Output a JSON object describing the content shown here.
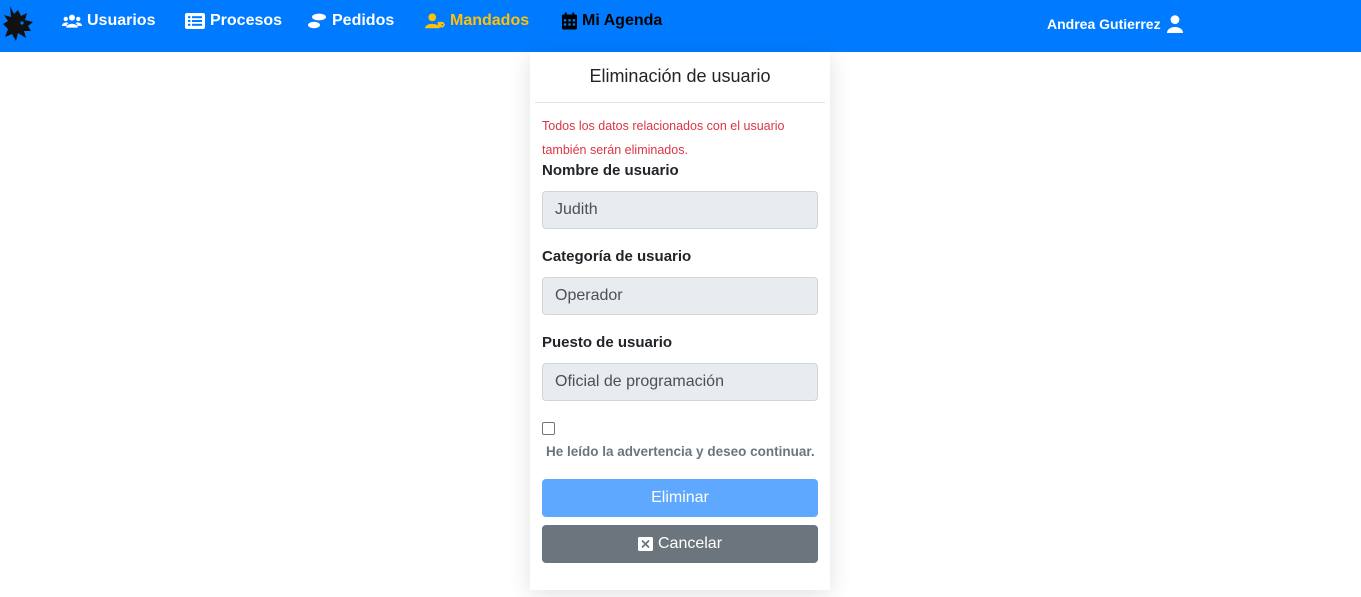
{
  "navbar": {
    "bg_color": "#007bff",
    "active_color": "#ffc107",
    "logo_icon": "wolf-head-logo",
    "items": [
      {
        "label": "Usuarios",
        "icon": "users-icon"
      },
      {
        "label": "Procesos",
        "icon": "list-alt-icon"
      },
      {
        "label": "Pedidos",
        "icon": "shoe-prints-icon"
      },
      {
        "label": "Mandados",
        "icon": "user-tag-icon",
        "active": true
      },
      {
        "label": "Mi Agenda",
        "icon": "calendar-icon"
      }
    ],
    "user": {
      "name": "Andrea Gutierrez",
      "icon": "user-icon"
    }
  },
  "card": {
    "title": "Eliminación de usuario",
    "warning": "Todos los datos relacionados con el usuario también serán eliminados.",
    "warning_color": "#dc3545",
    "fields": [
      {
        "label": "Nombre de usuario",
        "value": "Judith"
      },
      {
        "label": "Categoría de usuario",
        "value": "Operador"
      },
      {
        "label": "Puesto de usuario",
        "value": "Oficial de programación"
      }
    ],
    "confirm": {
      "label": "He leído la advertencia y deseo continuar.",
      "checked": false
    },
    "delete_button": {
      "label": "Eliminar",
      "color": "#5fa8ff"
    },
    "cancel_button": {
      "label": "Cancelar",
      "icon": "close-square-icon",
      "color": "#6c757d"
    }
  }
}
